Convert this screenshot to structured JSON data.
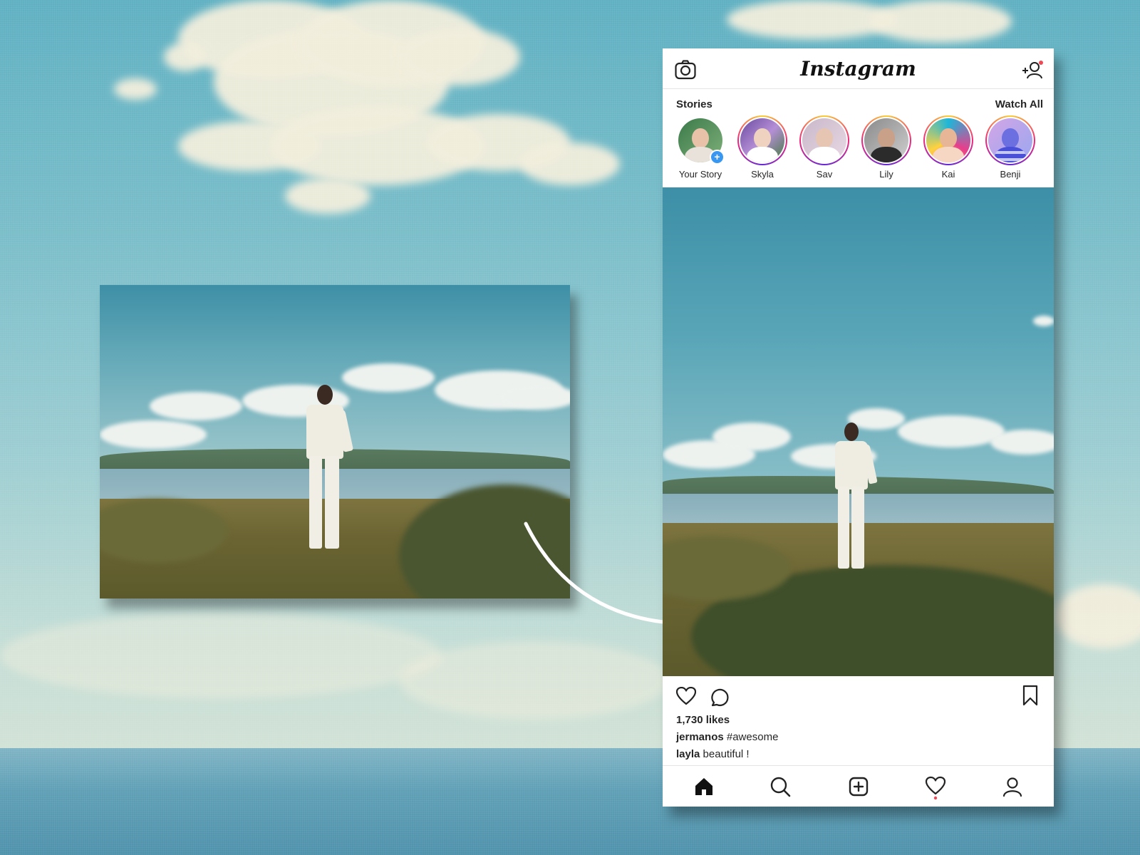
{
  "app": {
    "logo_text": "Instagram"
  },
  "header": {
    "camera_icon": "camera-icon",
    "add_user_icon": "add-user-icon",
    "notification_dot_color": "#ed4956"
  },
  "stories": {
    "title": "Stories",
    "watch_all_label": "Watch All",
    "items": [
      {
        "label": "Your Story",
        "own": true
      },
      {
        "label": "Skyla"
      },
      {
        "label": "Sav"
      },
      {
        "label": "Lily"
      },
      {
        "label": "Kai"
      },
      {
        "label": "Benji"
      }
    ],
    "add_badge": "+"
  },
  "post": {
    "likes": "1,730 likes",
    "caption_user": "jermanos",
    "caption_text": " #awesome",
    "comment_user": "layla",
    "comment_text": " beautiful !",
    "actions": [
      "heart-icon",
      "comment-icon",
      "bookmark-icon"
    ]
  },
  "nav": {
    "items": [
      "home-icon",
      "search-icon",
      "new-post-icon",
      "activity-icon",
      "profile-icon"
    ],
    "activity_dot_color": "#ed4956"
  },
  "colors": {
    "story_ring": [
      "#f9ce34",
      "#ee2a7b",
      "#6228d7"
    ],
    "plus_badge": "#3897f0",
    "text": "#262626"
  }
}
